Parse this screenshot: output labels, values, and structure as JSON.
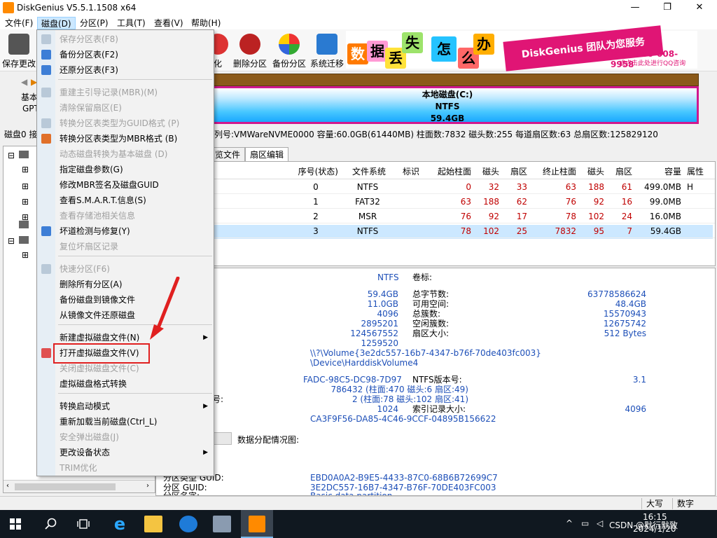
{
  "window": {
    "title": "DiskGenius V5.5.1.1508 x64",
    "controls": [
      "—",
      "❐",
      "✕"
    ]
  },
  "menubar": {
    "items": [
      "文件(F)",
      "磁盘(D)",
      "分区(P)",
      "工具(T)",
      "查看(V)",
      "帮助(H)"
    ]
  },
  "toolbar": {
    "buttons": [
      "保存更改",
      "化",
      "删除分区",
      "备份分区",
      "系统迁移"
    ]
  },
  "banner": {
    "chars": [
      "数",
      "据",
      "丢",
      "失",
      "怎",
      "么",
      "办"
    ],
    "tagline": "DiskGenius 团队为您服务",
    "phone": "致电：400-008-9958",
    "qq": "或点击此处进行QQ咨询"
  },
  "disk_nav": {
    "type_label": "基本",
    "style_label": "GPT"
  },
  "partition_bar": {
    "name": "本地磁盘(C:)",
    "fs": "NTFS",
    "size": "59.4GB"
  },
  "disk_info": {
    "left": "磁盘0 接",
    "text": "列号:VMWareNVME0000  容量:60.0GB(61440MB)  柱面数:7832  磁头数:255  每道扇区数:63  总扇区数:125829120"
  },
  "tabs": [
    "览文件",
    "扇区编辑"
  ],
  "partition_table": {
    "headers": [
      "序号(状态)",
      "文件系统",
      "标识",
      "起始柱面",
      "磁头",
      "扇区",
      "终止柱面",
      "磁头",
      "扇区",
      "容量",
      "属性"
    ],
    "rows": [
      {
        "name": "",
        "idx": "0",
        "fs": "NTFS",
        "id": "",
        "sc": "0",
        "sh": "32",
        "ss": "33",
        "ec": "63",
        "eh": "188",
        "es": "61",
        "size": "499.0MB",
        "attr": "H"
      },
      {
        "name": "",
        "idx": "1",
        "fs": "FAT32",
        "id": "",
        "sc": "63",
        "sh": "188",
        "ss": "62",
        "ec": "76",
        "eh": "92",
        "es": "16",
        "size": "99.0MB",
        "attr": ""
      },
      {
        "name": ")",
        "idx": "2",
        "fs": "MSR",
        "id": "",
        "sc": "76",
        "sh": "92",
        "ss": "17",
        "ec": "78",
        "eh": "102",
        "es": "24",
        "size": "16.0MB",
        "attr": ""
      },
      {
        "name": "盘(C:)",
        "idx": "3",
        "fs": "NTFS",
        "id": "",
        "sc": "78",
        "sh": "102",
        "ss": "25",
        "ec": "7832",
        "eh": "95",
        "es": "7",
        "size": "59.4GB",
        "attr": ""
      }
    ]
  },
  "details": {
    "fs_value": "NTFS",
    "vol_label_key": "卷标:",
    "left_values": [
      "59.4GB",
      "11.0GB",
      "4096",
      "2895201",
      "124567552",
      "1259520"
    ],
    "right_keys": [
      "总字节数:",
      "可用空间:",
      "总簇数:",
      "空闲簇数:",
      "扇区大小:"
    ],
    "right_values": [
      "63778586624",
      "48.4GB",
      "15570943",
      "12675742",
      "512 Bytes"
    ],
    "volume_path": "\\\\?\\Volume{3e2dc557-16b7-4347-b76f-70de403fc003}",
    "device_path": "\\Device\\HarddiskVolume4",
    "serial": "FADC-98C5-DC98-7D97",
    "ntfs_ver_key": "NTFS版本号:",
    "ntfs_ver": "3.1",
    "mft_loc": "786432 (柱面:470 磁头:6 扇区:49)",
    "mft_mirror": "2 (柱面:78 磁头:102 扇区:41)",
    "mft_prefix": "号:",
    "rec_size": "1024",
    "index_key": "索引记录大小:",
    "index_val": "4096",
    "guid_vol": "CA3F9F56-DA85-4C46-9CCF-04895B156622",
    "alloc_label": "数据分配情况图:",
    "type_guid_key": "分区类型 GUID:",
    "type_guid": "EBD0A0A2-B9E5-4433-87C0-68B6B72699C7",
    "part_guid_key": "分区 GUID:",
    "part_guid": "3E2DC557-16B7-4347-B76F-70DE403FC003",
    "part_name_key": "分区名字:",
    "part_name": "Basic data partition"
  },
  "statusbar": {
    "caps": "大写",
    "num": "数字"
  },
  "dropdown": {
    "items": [
      {
        "label": "保存分区表(F8)",
        "disabled": true
      },
      {
        "label": "备份分区表(F2)",
        "disabled": false
      },
      {
        "label": "还原分区表(F3)",
        "disabled": false
      },
      {
        "label": "重建主引导记录(MBR)(M)",
        "disabled": true
      },
      {
        "label": "清除保留扇区(E)",
        "disabled": true
      },
      {
        "label": "转换分区表类型为GUID格式 (P)",
        "disabled": true
      },
      {
        "label": "转换分区表类型为MBR格式 (B)",
        "disabled": false
      },
      {
        "label": "动态磁盘转换为基本磁盘 (D)",
        "disabled": true
      },
      {
        "label": "指定磁盘参数(G)",
        "disabled": false
      },
      {
        "label": "修改MBR签名及磁盘GUID",
        "disabled": false
      },
      {
        "label": "查看S.M.A.R.T.信息(S)",
        "disabled": false
      },
      {
        "label": "查看存储池相关信息",
        "disabled": true
      },
      {
        "label": "坏道检测与修复(Y)",
        "disabled": false
      },
      {
        "label": "复位坏扇区记录",
        "disabled": true
      },
      {
        "label": "快速分区(F6)",
        "disabled": true
      },
      {
        "label": "删除所有分区(A)",
        "disabled": false
      },
      {
        "label": "备份磁盘到镜像文件",
        "disabled": false
      },
      {
        "label": "从镜像文件还原磁盘",
        "disabled": false
      },
      {
        "label": "新建虚拟磁盘文件(N)",
        "disabled": false
      },
      {
        "label": "打开虚拟磁盘文件(V)",
        "disabled": false
      },
      {
        "label": "关闭虚拟磁盘文件(C)",
        "disabled": true
      },
      {
        "label": "虚拟磁盘格式转换",
        "disabled": false
      },
      {
        "label": "转换启动模式",
        "disabled": false
      },
      {
        "label": "重新加载当前磁盘(Ctrl_L)",
        "disabled": false
      },
      {
        "label": "安全弹出磁盘(J)",
        "disabled": true
      },
      {
        "label": "更改设备状态",
        "disabled": false
      },
      {
        "label": "TRIM优化",
        "disabled": true
      }
    ]
  },
  "taskbar": {
    "time": "16:15",
    "date": "2024/1/20",
    "tray_text": "CSDN @默行默致"
  },
  "colors": {
    "accent": "#0078d7",
    "highlight": "#e02020"
  }
}
